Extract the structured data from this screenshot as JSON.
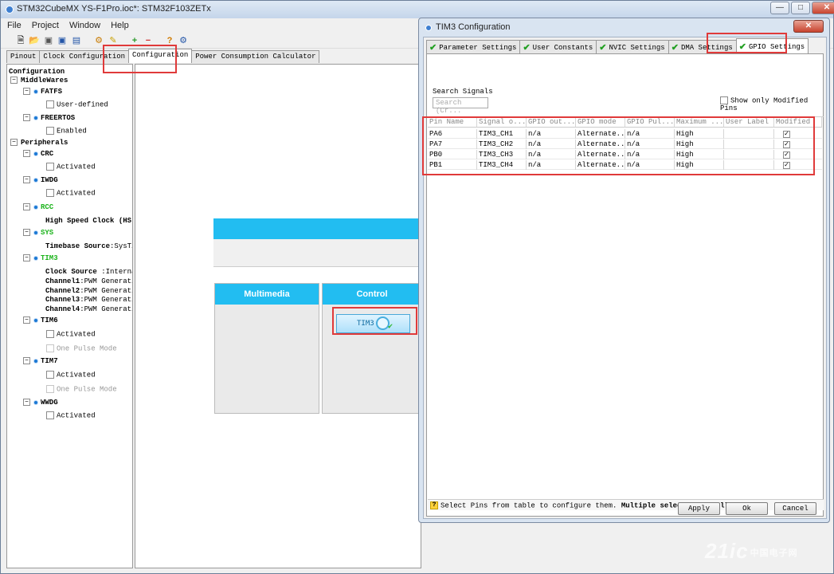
{
  "main_window": {
    "title": "STM32CubeMX YS-F1Pro.ioc*: STM32F103ZETx",
    "controls": [
      "—",
      "□",
      "✕"
    ]
  },
  "menu": [
    "File",
    "Project",
    "Window",
    "Help"
  ],
  "toolbar_icons": [
    "new-project-icon",
    "open-project-icon",
    "save-icon",
    "save-as-icon",
    "generate-code-icon",
    "report-icon",
    "zoom-in-icon",
    "zoom-out-icon",
    "help-icon",
    "about-icon"
  ],
  "main_tabs": [
    "Pinout",
    "Clock Configuration",
    "Configuration",
    "Power Consumption Calculator"
  ],
  "tree": {
    "root": "Configuration",
    "middlewares": "MiddleWares",
    "fatfs": "FATFS",
    "fatfs_user_defined": "User-defined",
    "freertos": "FREERTOS",
    "freertos_enabled": "Enabled",
    "peripherals": "Peripherals",
    "crc": "CRC",
    "crc_activated": "Activated",
    "iwdg": "IWDG",
    "iwdg_activated": "Activated",
    "rcc": "RCC",
    "rcc_hse_label": "High Speed Clock (HS",
    "sys": "SYS",
    "sys_timebase_label": "Timebase Source",
    "sys_timebase_value": ":SysTi",
    "tim3": "TIM3",
    "tim3_clock_label": "Clock Source",
    "tim3_clock_value": ":Interna",
    "tim3_ch1_label": "Channel1",
    "tim3_ch1_value": ":PWM Generatio",
    "tim3_ch2_label": "Channel2",
    "tim3_ch2_value": ":PWM Generatio",
    "tim3_ch3_label": "Channel3",
    "tim3_ch3_value": ":PWM Generatio",
    "tim3_ch4_label": "Channel4",
    "tim3_ch4_value": ":PWM Generatio",
    "tim6": "TIM6",
    "tim6_activated": "Activated",
    "tim6_one_pulse": "One Pulse Mode",
    "tim7": "TIM7",
    "tim7_activated": "Activated",
    "tim7_one_pulse": "One Pulse Mode",
    "wwdg": "WWDG",
    "wwdg_activated": "Activated"
  },
  "canvas": {
    "multimedia": "Multimedia",
    "control": "Control",
    "tim3_button": "TIM3"
  },
  "dialog": {
    "title": "TIM3 Configuration",
    "close": "✕",
    "tabs": [
      "Parameter Settings",
      "User Constants",
      "NVIC Settings",
      "DMA Settings",
      "GPIO Settings"
    ],
    "search_label": "Search Signals",
    "search_placeholder": "Search (Cr...",
    "modified_only_label": "Show only Modified Pins",
    "columns": [
      "Pin Name",
      "Signal o...",
      "GPIO out...",
      "GPIO mode",
      "GPIO Pul...",
      "Maximum ...",
      "User Label",
      "Modified"
    ],
    "rows": [
      [
        "PA6",
        "TIM3_CH1",
        "n/a",
        "Alternate...",
        "n/a",
        "High",
        ""
      ],
      [
        "PA7",
        "TIM3_CH2",
        "n/a",
        "Alternate...",
        "n/a",
        "High",
        ""
      ],
      [
        "PB0",
        "TIM3_CH3",
        "n/a",
        "Alternate...",
        "n/a",
        "High",
        ""
      ],
      [
        "PB1",
        "TIM3_CH4",
        "n/a",
        "Alternate...",
        "n/a",
        "High",
        ""
      ]
    ],
    "status_normal": "Select Pins from table to configure them.",
    "status_bold": "Multiple selection is Allowed.",
    "apply": "Apply",
    "ok": "Ok",
    "cancel": "Cancel"
  },
  "watermark": {
    "text": "21ic",
    "sub": "中国电子网"
  },
  "colors": {
    "accent_blue": "#22bdf1",
    "highlight_red": "#e03a3a",
    "check_green": "#22a022"
  }
}
